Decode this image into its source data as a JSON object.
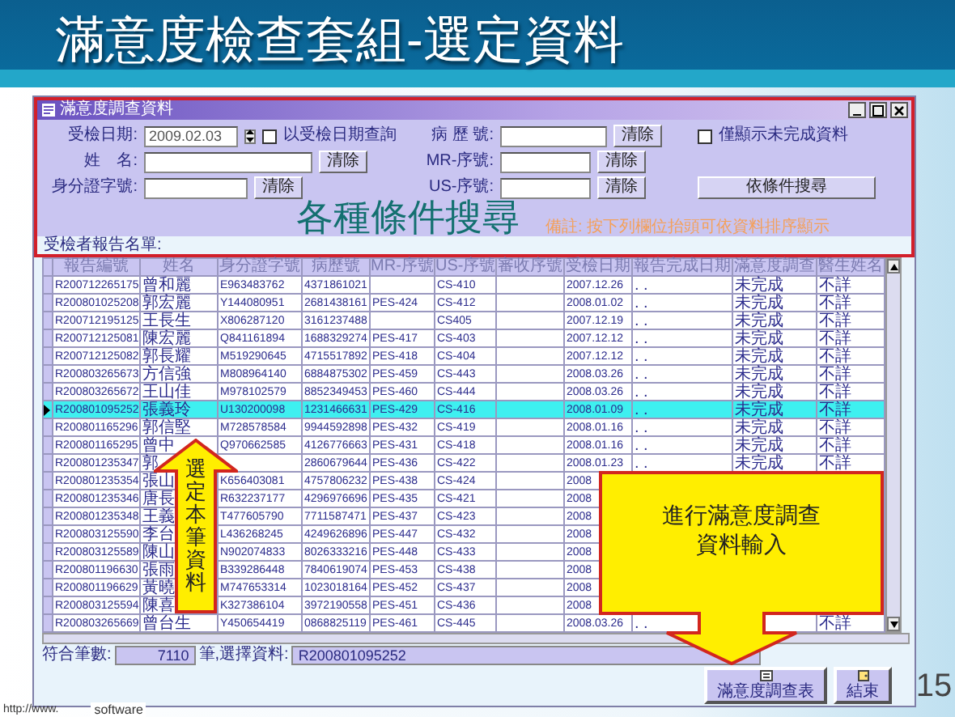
{
  "slide": {
    "title": "滿意度檢查套組-選定資料",
    "page_number": "15",
    "footer_url": "http://www.",
    "footer_logo": "software"
  },
  "window": {
    "title": "滿意度調查資料"
  },
  "filters": {
    "date": {
      "label": "受檢日期:",
      "value": "2009.02.03"
    },
    "date_check": {
      "label": "以受檢日期查詢",
      "checked": false
    },
    "name": {
      "label": "姓　名:",
      "clear": "清除"
    },
    "id_no": {
      "label": "身分證字號:",
      "clear": "清除"
    },
    "chart_no": {
      "label": "病 歷 號:",
      "clear": "清除"
    },
    "mr_no": {
      "label": "MR-序號:",
      "clear": "清除"
    },
    "us_no": {
      "label": "US-序號:",
      "clear": "清除"
    },
    "incomplete_only": {
      "label": "僅顯示未完成資料",
      "checked": false
    },
    "search_button": "依條件搜尋",
    "note": "備註: 按下列欄位抬頭可依資料排序顯示"
  },
  "search_callout": "各種條件搜尋",
  "list_label": "受檢者報告名單:",
  "table": {
    "columns": [
      "報告編號",
      "姓名",
      "身分證字號",
      "病歷號",
      "MR-序號",
      "US-序號",
      "審收序號",
      "受檢日期",
      "報告完成日期",
      "滿意度調查",
      "醫生姓名"
    ],
    "rows": [
      {
        "selected": false,
        "cells": [
          "R200712265175",
          "曾和麗",
          "E963483762",
          "4371861021",
          null,
          "CS-410",
          null,
          "2007.12.26",
          ". .",
          "未完成",
          "不詳"
        ]
      },
      {
        "selected": false,
        "cells": [
          "R200801025208",
          "郭宏麗",
          "Y144080951",
          "2681438161",
          "PES-424",
          "CS-412",
          null,
          "2008.01.02",
          ". .",
          "未完成",
          "不詳"
        ]
      },
      {
        "selected": false,
        "cells": [
          "R200712195125",
          "王長生",
          "X806287120",
          "3161237488",
          null,
          "CS405",
          null,
          "2007.12.19",
          ". .",
          "未完成",
          "不詳"
        ]
      },
      {
        "selected": false,
        "cells": [
          "R200712125081",
          "陳宏麗",
          "Q841161894",
          "1688329274",
          "PES-417",
          "CS-403",
          null,
          "2007.12.12",
          ". .",
          "未完成",
          "不詳"
        ]
      },
      {
        "selected": false,
        "cells": [
          "R200712125082",
          "郭長耀",
          "M519290645",
          "4715517892",
          "PES-418",
          "CS-404",
          null,
          "2007.12.12",
          ". .",
          "未完成",
          "不詳"
        ]
      },
      {
        "selected": false,
        "cells": [
          "R200803265673",
          "方信強",
          "M808964140",
          "6884875302",
          "PES-459",
          "CS-443",
          null,
          "2008.03.26",
          ". .",
          "未完成",
          "不詳"
        ]
      },
      {
        "selected": false,
        "cells": [
          "R200803265672",
          "王山佳",
          "M978102579",
          "8852349453",
          "PES-460",
          "CS-444",
          null,
          "2008.03.26",
          ". .",
          "未完成",
          "不詳"
        ]
      },
      {
        "selected": true,
        "cells": [
          "R200801095252",
          "張義玲",
          "U130200098",
          "1231466631",
          "PES-429",
          "CS-416",
          null,
          "2008.01.09",
          ". .",
          "未完成",
          "不詳"
        ]
      },
      {
        "selected": false,
        "cells": [
          "R200801165296",
          "郭信堅",
          "M728578584",
          "9944592898",
          "PES-432",
          "CS-419",
          null,
          "2008.01.16",
          ". .",
          "未完成",
          "不詳"
        ]
      },
      {
        "selected": false,
        "cells": [
          "R200801165295",
          "曾中",
          "Q970662585",
          "4126776663",
          "PES-431",
          "CS-418",
          null,
          "2008.01.16",
          ". .",
          "未完成",
          "不詳"
        ]
      },
      {
        "selected": false,
        "cells": [
          "R200801235347",
          "郭",
          null,
          "2860679644",
          "PES-436",
          "CS-422",
          null,
          "2008.01.23",
          ". .",
          "未完成",
          "不詳"
        ]
      },
      {
        "selected": false,
        "cells": [
          "R200801235354",
          "張山",
          "K656403081",
          "4757806232",
          "PES-438",
          "CS-424",
          null,
          "2008",
          null,
          null,
          null
        ]
      },
      {
        "selected": false,
        "cells": [
          "R200801235346",
          "唐長",
          "R632237177",
          "4296976696",
          "PES-435",
          "CS-421",
          null,
          "2008",
          null,
          null,
          null
        ]
      },
      {
        "selected": false,
        "cells": [
          "R200801235348",
          "王義",
          "T477605790",
          "7711587471",
          "PES-437",
          "CS-423",
          null,
          "2008",
          null,
          null,
          null
        ]
      },
      {
        "selected": false,
        "cells": [
          "R200803125590",
          "李台",
          "L436268245",
          "4249626896",
          "PES-447",
          "CS-432",
          null,
          "2008",
          null,
          null,
          null
        ]
      },
      {
        "selected": false,
        "cells": [
          "R200803125589",
          "陳山",
          "N902074833",
          "8026333216",
          "PES-448",
          "CS-433",
          null,
          "2008",
          null,
          null,
          null
        ]
      },
      {
        "selected": false,
        "cells": [
          "R200801196630",
          "張雨",
          "B339286448",
          "7840619074",
          "PES-453",
          "CS-438",
          null,
          "2008",
          null,
          null,
          null
        ]
      },
      {
        "selected": false,
        "cells": [
          "R200801196629",
          "黃曉",
          "M747653314",
          "1023018164",
          "PES-452",
          "CS-437",
          null,
          "2008",
          null,
          null,
          null
        ]
      },
      {
        "selected": false,
        "cells": [
          "R200803125594",
          "陳喜",
          "K327386104",
          "3972190558",
          "PES-451",
          "CS-436",
          null,
          "2008",
          null,
          null,
          null
        ]
      },
      {
        "selected": false,
        "cells": [
          "R200803265669",
          "曾台生",
          "Y450654419",
          "0868825119",
          "PES-461",
          "CS-445",
          null,
          "2008.03.26",
          ". .",
          null,
          "不詳"
        ]
      }
    ]
  },
  "status": {
    "count_label": "符合筆數:",
    "count": "7110",
    "select_label": "筆,選擇資料:",
    "selected_id": "R200801095252"
  },
  "buttons": [
    {
      "kind": "survey",
      "label": "滿意度調查表"
    },
    {
      "kind": "exit",
      "label": "結束"
    }
  ],
  "callouts": {
    "select_row": "選定本筆資料",
    "enter_data": [
      "進行滿意度調查",
      "資料輸入"
    ]
  }
}
